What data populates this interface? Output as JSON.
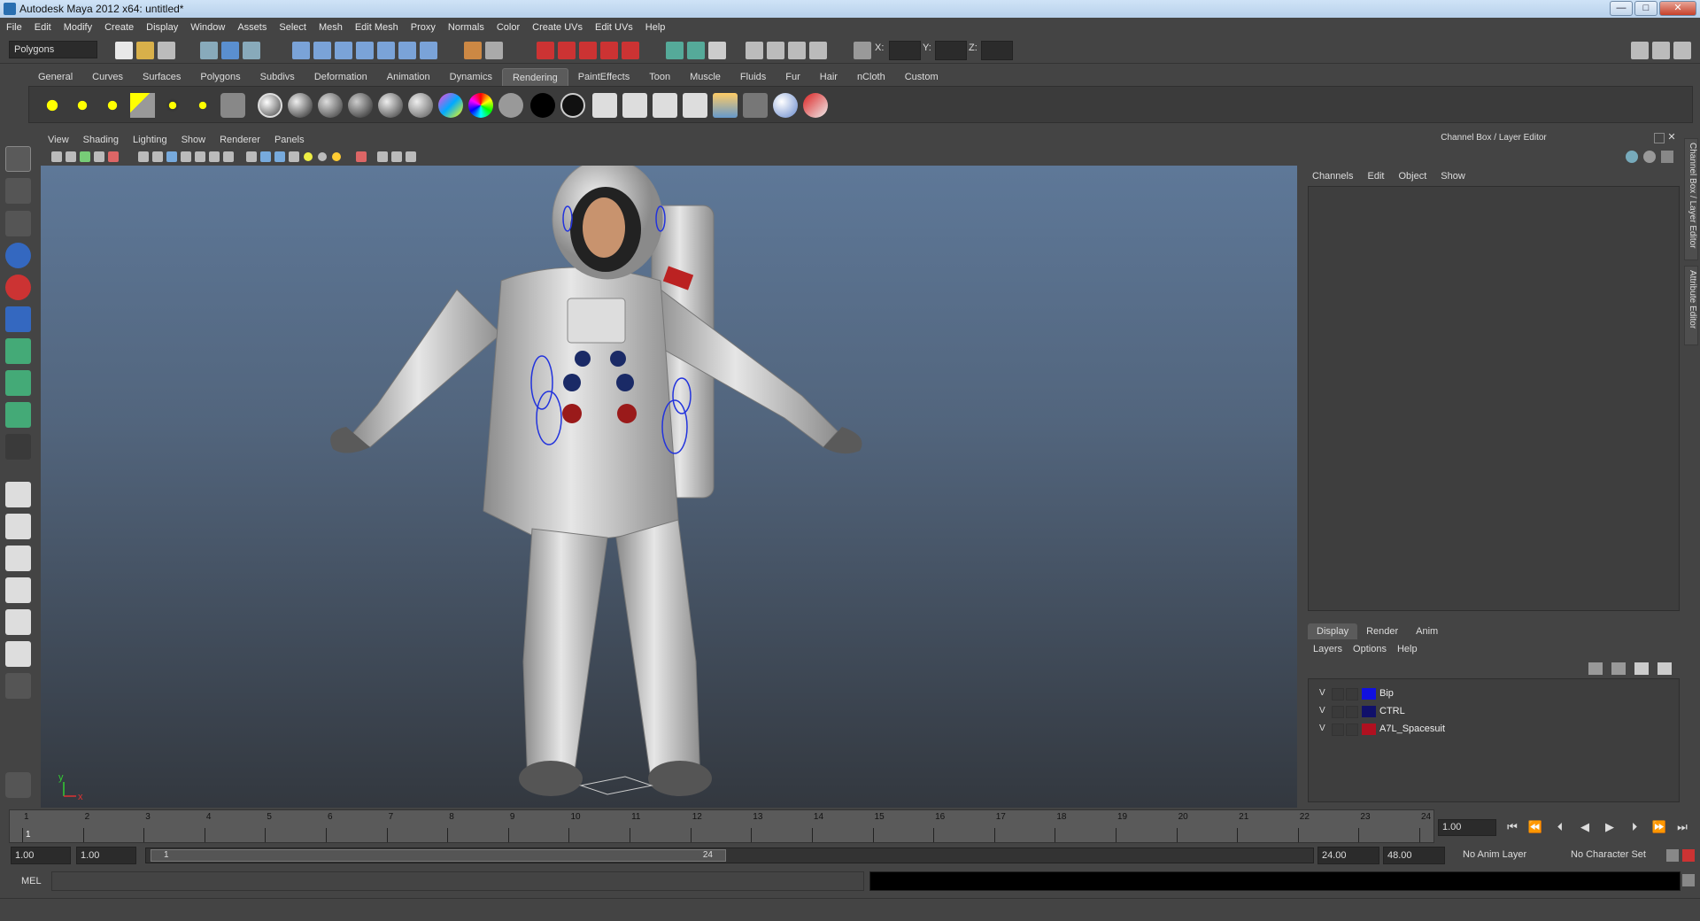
{
  "window": {
    "title": "Autodesk Maya 2012 x64: untitled*",
    "min": "—",
    "max": "□",
    "close": "✕"
  },
  "menubar": [
    "File",
    "Edit",
    "Modify",
    "Create",
    "Display",
    "Window",
    "Assets",
    "Select",
    "Mesh",
    "Edit Mesh",
    "Proxy",
    "Normals",
    "Color",
    "Create UVs",
    "Edit UVs",
    "Help"
  ],
  "statusline": {
    "mode": "Polygons",
    "x_label": "X:",
    "y_label": "Y:",
    "z_label": "Z:"
  },
  "shelf_tabs": [
    "General",
    "Curves",
    "Surfaces",
    "Polygons",
    "Subdivs",
    "Deformation",
    "Animation",
    "Dynamics",
    "Rendering",
    "PaintEffects",
    "Toon",
    "Muscle",
    "Fluids",
    "Fur",
    "Hair",
    "nCloth",
    "Custom"
  ],
  "shelf_active": "Rendering",
  "panel_menu": [
    "View",
    "Shading",
    "Lighting",
    "Show",
    "Renderer",
    "Panels"
  ],
  "viewport": {
    "axis_y": "y",
    "axis_x": "x"
  },
  "channel_box": {
    "title": "Channel Box / Layer Editor",
    "menu": [
      "Channels",
      "Edit",
      "Object",
      "Show"
    ]
  },
  "side_tabs": [
    "Channel Box / Layer Editor",
    "Attribute Editor"
  ],
  "layer_editor": {
    "tabs": [
      "Display",
      "Render",
      "Anim"
    ],
    "active_tab": "Display",
    "menu": [
      "Layers",
      "Options",
      "Help"
    ],
    "layers": [
      {
        "visible": "V",
        "name": "Bip",
        "color": "#1010e0"
      },
      {
        "visible": "V",
        "name": "CTRL",
        "color": "#10106a"
      },
      {
        "visible": "V",
        "name": "A7L_Spacesuit",
        "color": "#b01020"
      }
    ]
  },
  "timeslider": {
    "frames": [
      "1",
      "2",
      "3",
      "4",
      "5",
      "6",
      "7",
      "8",
      "9",
      "10",
      "11",
      "12",
      "13",
      "14",
      "15",
      "16",
      "17",
      "18",
      "19",
      "20",
      "21",
      "22",
      "23",
      "24"
    ],
    "current_frame_marker": "1",
    "current_frame": "1.00"
  },
  "range": {
    "start": "1.00",
    "anim_start": "1.00",
    "range_start_label": "1",
    "range_end_label": "24",
    "playback_end": "24.00",
    "anim_end": "48.00",
    "anim_layer": "No Anim Layer",
    "character_set": "No Character Set"
  },
  "command_line": {
    "label": "MEL"
  },
  "colors": {
    "ui_bg": "#444444",
    "viewport_top": "#5e7898",
    "viewport_bottom": "#33383f"
  }
}
